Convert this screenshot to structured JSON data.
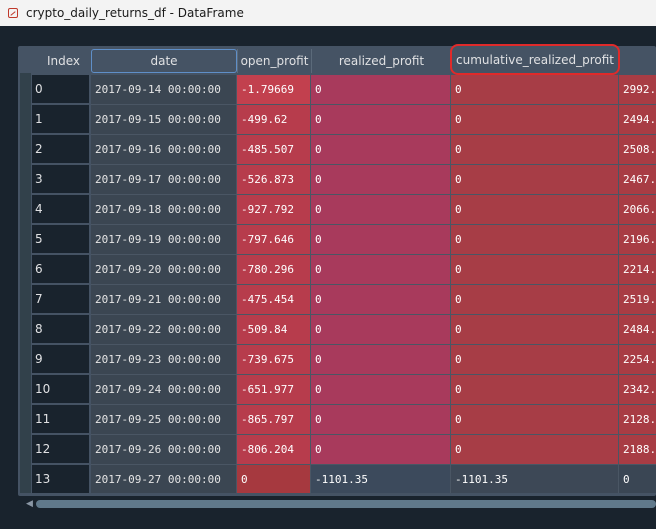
{
  "window": {
    "title": "crypto_daily_returns_df - DataFrame",
    "icon": "dataframe-icon"
  },
  "columns": {
    "index": "Index",
    "date": "date",
    "open_profit": "open_profit",
    "realized_profit": "realized_profit",
    "cumulative_realized_profit": "cumulative_realized_profit"
  },
  "rows": [
    {
      "index": "0",
      "date": "2017-09-14 00:00:00",
      "open_profit": "-1.79669",
      "realized_profit": "0",
      "cumulative_realized_profit": "0",
      "next": "2992."
    },
    {
      "index": "1",
      "date": "2017-09-15 00:00:00",
      "open_profit": "-499.62",
      "realized_profit": "0",
      "cumulative_realized_profit": "0",
      "next": "2494."
    },
    {
      "index": "2",
      "date": "2017-09-16 00:00:00",
      "open_profit": "-485.507",
      "realized_profit": "0",
      "cumulative_realized_profit": "0",
      "next": "2508."
    },
    {
      "index": "3",
      "date": "2017-09-17 00:00:00",
      "open_profit": "-526.873",
      "realized_profit": "0",
      "cumulative_realized_profit": "0",
      "next": "2467."
    },
    {
      "index": "4",
      "date": "2017-09-18 00:00:00",
      "open_profit": "-927.792",
      "realized_profit": "0",
      "cumulative_realized_profit": "0",
      "next": "2066."
    },
    {
      "index": "5",
      "date": "2017-09-19 00:00:00",
      "open_profit": "-797.646",
      "realized_profit": "0",
      "cumulative_realized_profit": "0",
      "next": "2196."
    },
    {
      "index": "6",
      "date": "2017-09-20 00:00:00",
      "open_profit": "-780.296",
      "realized_profit": "0",
      "cumulative_realized_profit": "0",
      "next": "2214."
    },
    {
      "index": "7",
      "date": "2017-09-21 00:00:00",
      "open_profit": "-475.454",
      "realized_profit": "0",
      "cumulative_realized_profit": "0",
      "next": "2519."
    },
    {
      "index": "8",
      "date": "2017-09-22 00:00:00",
      "open_profit": "-509.84",
      "realized_profit": "0",
      "cumulative_realized_profit": "0",
      "next": "2484."
    },
    {
      "index": "9",
      "date": "2017-09-23 00:00:00",
      "open_profit": "-739.675",
      "realized_profit": "0",
      "cumulative_realized_profit": "0",
      "next": "2254."
    },
    {
      "index": "10",
      "date": "2017-09-24 00:00:00",
      "open_profit": "-651.977",
      "realized_profit": "0",
      "cumulative_realized_profit": "0",
      "next": "2342."
    },
    {
      "index": "11",
      "date": "2017-09-25 00:00:00",
      "open_profit": "-865.797",
      "realized_profit": "0",
      "cumulative_realized_profit": "0",
      "next": "2128."
    },
    {
      "index": "12",
      "date": "2017-09-26 00:00:00",
      "open_profit": "-806.204",
      "realized_profit": "0",
      "cumulative_realized_profit": "0",
      "next": "2188."
    },
    {
      "index": "13",
      "date": "2017-09-27 00:00:00",
      "open_profit": "0",
      "realized_profit": "-1101.35",
      "cumulative_realized_profit": "-1101.35",
      "next": "0"
    }
  ],
  "cell_colors": {
    "open_profit": [
      "#c2404e",
      "#b73c4c",
      "#b73c4c",
      "#b73c4c",
      "#b73c4c",
      "#b73c4c",
      "#b73c4c",
      "#b73c4c",
      "#b73c4c",
      "#b73c4c",
      "#b73c4c",
      "#b73c4c",
      "#b73c4c",
      "#a6393f"
    ],
    "realized_profit": [
      "#a83a5c",
      "#a83a5c",
      "#a83a5c",
      "#a83a5c",
      "#a83a5c",
      "#a83a5c",
      "#a83a5c",
      "#a83a5c",
      "#a83a5c",
      "#a83a5c",
      "#a83a5c",
      "#a83a5c",
      "#a83a5c",
      "#3c4a5c"
    ],
    "cumulative_realized_profit": [
      "#a73d46",
      "#a73d46",
      "#a73d46",
      "#a73d46",
      "#a73d46",
      "#a73d46",
      "#a73d46",
      "#a73d46",
      "#a73d46",
      "#a73d46",
      "#a73d46",
      "#a73d46",
      "#a73d46",
      "#3d4856"
    ],
    "next": [
      "#a83c44",
      "#a83c44",
      "#a83c44",
      "#a83c44",
      "#a83c44",
      "#a83c44",
      "#a83c44",
      "#a83c44",
      "#a83c44",
      "#a83c44",
      "#a83c44",
      "#a83c44",
      "#a83c44",
      "#3a4654"
    ]
  },
  "highlight_color": "#e02a2a",
  "scrollbar": {
    "horizontal": "visible"
  }
}
